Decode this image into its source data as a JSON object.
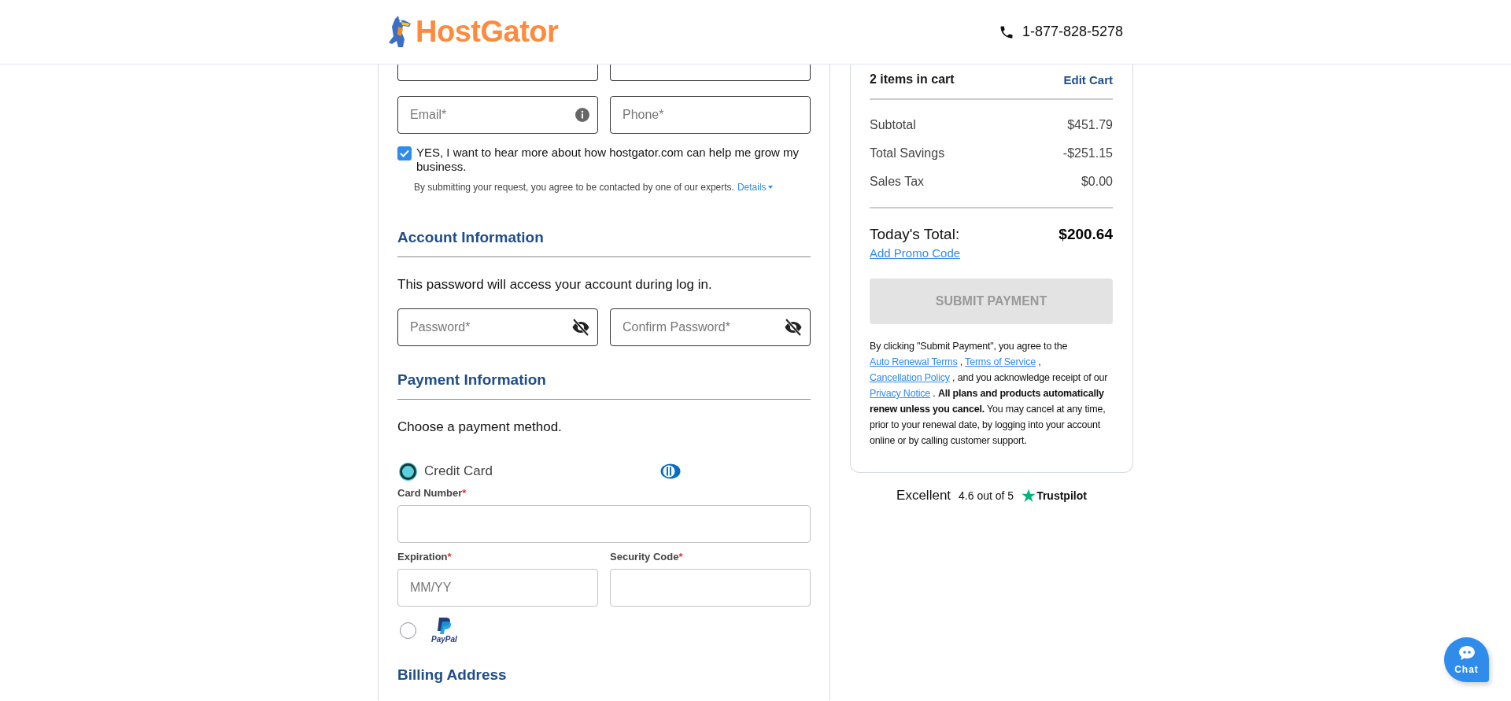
{
  "header": {
    "logo_text": "HostGator",
    "phone": "1-877-828-5278"
  },
  "contact_fields": [
    {
      "placeholder": "Email*",
      "kind": "info"
    },
    {
      "placeholder": "Phone*",
      "kind": "plain"
    }
  ],
  "marketing_opt_in": {
    "checked": true,
    "label": "YES, I want to hear more about how hostgator.com can help me grow my business.",
    "note": "By submitting your request, you agree to be contacted by one of our experts.",
    "details_link": "Details"
  },
  "account_section": {
    "title": "Account Information",
    "intro": "This password will access your account during log in.",
    "fields": [
      {
        "placeholder": "Password*"
      },
      {
        "placeholder": "Confirm Password*"
      }
    ]
  },
  "payment_section": {
    "title": "Payment Information",
    "intro": "Choose a payment method.",
    "methods": [
      {
        "kind": "card",
        "label": "Credit Card",
        "selected": true
      },
      {
        "kind": "paypal",
        "logo_text": "PayPal",
        "selected": false
      }
    ],
    "card_fields": [
      {
        "label": "Card Number",
        "required_mark": "*"
      },
      {
        "label": "Expiration",
        "required_mark": "*",
        "placeholder": "MM/YY"
      },
      {
        "label": "Security Code",
        "required_mark": "*"
      }
    ]
  },
  "billing_section": {
    "title": "Billing Address"
  },
  "cart": {
    "title": "2 items in cart",
    "edit_link": "Edit Cart",
    "rows": [
      {
        "label": "Subtotal",
        "value": "$451.79"
      },
      {
        "label": "Total Savings",
        "value": "-$251.15"
      },
      {
        "label": "Sales Tax",
        "value": "$0.00"
      }
    ],
    "total_label": "Today's Total:",
    "total_value": "$200.64",
    "promo_link": "Add Promo Code",
    "submit": {
      "label": "SUBMIT PAYMENT",
      "disabled": true
    },
    "legal": [
      {
        "kind": "text",
        "text": " By clicking \"Submit Payment\", you agree to the "
      },
      {
        "kind": "link",
        "text": "Auto Renewal Terms"
      },
      {
        "kind": "text",
        "text": " , "
      },
      {
        "kind": "link",
        "text": "Terms of Service"
      },
      {
        "kind": "text",
        "text": " , "
      },
      {
        "kind": "link",
        "text": "Cancellation Policy"
      },
      {
        "kind": "text",
        "text": " , and you acknowledge receipt of our "
      },
      {
        "kind": "link",
        "text": "Privacy Notice"
      },
      {
        "kind": "text",
        "text": " . "
      },
      {
        "kind": "bold",
        "text": "All plans and products automatically renew unless you cancel."
      },
      {
        "kind": "text",
        "text": " You may cancel at any time, prior to your renewal date, by logging into your account online or by calling customer support."
      }
    ]
  },
  "trustpilot": {
    "rating_word": "Excellent",
    "score": "4.6 out of 5",
    "brand": "Trustpilot"
  },
  "chat": {
    "label": "Chat"
  }
}
